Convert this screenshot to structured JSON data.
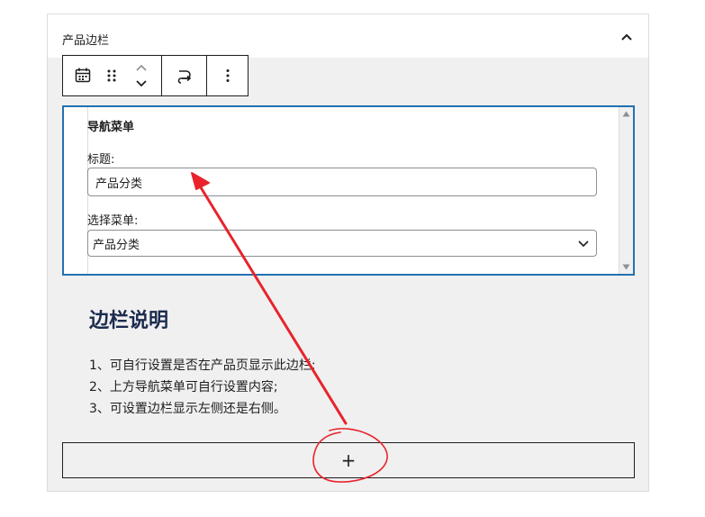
{
  "panel": {
    "title": "产品边栏"
  },
  "toolbar": {
    "icons": [
      "calendar-icon",
      "drag-handle-icon",
      "move-up-icon",
      "move-down-icon",
      "transform-icon",
      "more-options-icon"
    ]
  },
  "widget": {
    "title": "导航菜单",
    "title_field_label": "标题:",
    "title_field_value": "产品分类",
    "menu_field_label": "选择菜单:",
    "menu_field_value": "产品分类"
  },
  "content": {
    "heading": "边栏说明",
    "lines": [
      "1、可自行设置是否在产品页显示此边栏;",
      "2、上方导航菜单可自行设置内容;",
      "3、可设置边栏显示左侧还是右侧。"
    ]
  },
  "add_block": {
    "label": "+"
  },
  "annotation": {
    "color": "#e8232c"
  }
}
